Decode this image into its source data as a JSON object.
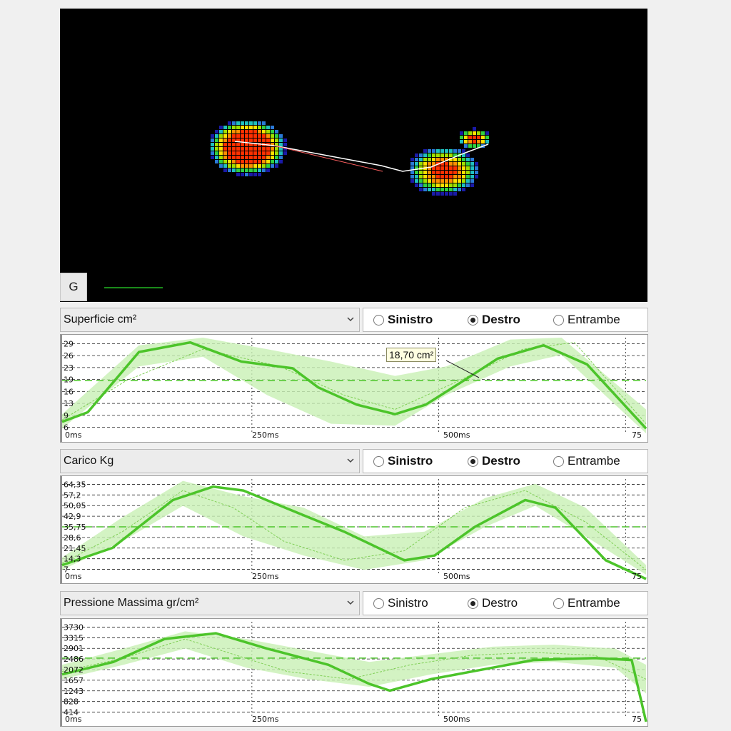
{
  "viewer": {
    "g_button_label": "G"
  },
  "panels": [
    {
      "dropdown_label": "Superficie cm²",
      "radios": [
        {
          "label": "Sinistro",
          "checked": false
        },
        {
          "label": "Destro",
          "checked": true
        },
        {
          "label": "Entrambe",
          "checked": false
        }
      ],
      "labels_bold": true,
      "tooltip": "18,70 cm²",
      "y_ticks": [
        "29",
        "26",
        "23",
        "19",
        "16",
        "13",
        "9",
        "6"
      ],
      "x_ticks": [
        "0ms",
        "250ms",
        "500ms",
        "75"
      ],
      "main_line": [
        [
          0,
          12
        ],
        [
          0.1,
          22
        ],
        [
          0.3,
          85
        ],
        [
          0.5,
          95
        ],
        [
          0.7,
          75
        ],
        [
          0.9,
          68
        ],
        [
          1.0,
          48
        ],
        [
          1.15,
          30
        ],
        [
          1.3,
          20
        ],
        [
          1.42,
          30
        ],
        [
          1.55,
          52
        ],
        [
          1.7,
          78
        ],
        [
          1.88,
          92
        ],
        [
          2.05,
          72
        ],
        [
          2.28,
          5
        ]
      ],
      "ghost_line": [
        [
          0,
          14
        ],
        [
          0.25,
          55
        ],
        [
          0.55,
          88
        ],
        [
          0.85,
          70
        ],
        [
          1.1,
          40
        ],
        [
          1.3,
          25
        ],
        [
          1.55,
          55
        ],
        [
          1.8,
          88
        ],
        [
          2.0,
          95
        ],
        [
          2.28,
          10
        ]
      ],
      "band_upper": [
        [
          0,
          20
        ],
        [
          0.3,
          92
        ],
        [
          0.55,
          100
        ],
        [
          0.8,
          88
        ],
        [
          1.05,
          75
        ],
        [
          1.3,
          60
        ],
        [
          1.5,
          70
        ],
        [
          1.75,
          98
        ],
        [
          1.95,
          100
        ],
        [
          2.28,
          25
        ]
      ],
      "band_lower": [
        [
          0,
          5
        ],
        [
          0.3,
          70
        ],
        [
          0.55,
          80
        ],
        [
          0.8,
          40
        ],
        [
          1.05,
          10
        ],
        [
          1.3,
          8
        ],
        [
          1.5,
          40
        ],
        [
          1.75,
          70
        ],
        [
          1.95,
          82
        ],
        [
          2.28,
          0
        ]
      ],
      "dash_level": 55
    },
    {
      "dropdown_label": "Carico Kg",
      "radios": [
        {
          "label": "Sinistro",
          "checked": false
        },
        {
          "label": "Destro",
          "checked": true
        },
        {
          "label": "Entrambe",
          "checked": false
        }
      ],
      "labels_bold": true,
      "tooltip": "",
      "y_ticks": [
        "64,35",
        "57,2",
        "50,05",
        "42,9",
        "35,75",
        "28,6",
        "21,45",
        "14,3",
        "7"
      ],
      "x_ticks": [
        "0ms",
        "250ms",
        "500ms",
        "75"
      ],
      "main_line": [
        [
          0,
          10
        ],
        [
          0.25,
          28
        ],
        [
          0.55,
          78
        ],
        [
          0.75,
          92
        ],
        [
          0.9,
          88
        ],
        [
          1.2,
          62
        ],
        [
          1.4,
          45
        ],
        [
          1.55,
          30
        ],
        [
          1.7,
          15
        ],
        [
          1.85,
          20
        ],
        [
          2.05,
          50
        ],
        [
          2.3,
          78
        ],
        [
          2.45,
          70
        ],
        [
          2.7,
          15
        ],
        [
          2.9,
          -5
        ]
      ],
      "ghost_line": [
        [
          0,
          12
        ],
        [
          0.3,
          45
        ],
        [
          0.6,
          88
        ],
        [
          0.85,
          70
        ],
        [
          1.1,
          35
        ],
        [
          1.4,
          15
        ],
        [
          1.7,
          25
        ],
        [
          2.0,
          70
        ],
        [
          2.3,
          88
        ],
        [
          2.6,
          55
        ],
        [
          2.9,
          5
        ]
      ],
      "band_upper": [
        [
          0,
          18
        ],
        [
          0.3,
          60
        ],
        [
          0.6,
          98
        ],
        [
          0.9,
          82
        ],
        [
          1.2,
          70
        ],
        [
          1.5,
          40
        ],
        [
          1.8,
          45
        ],
        [
          2.1,
          80
        ],
        [
          2.35,
          95
        ],
        [
          2.6,
          70
        ],
        [
          2.9,
          10
        ]
      ],
      "band_lower": [
        [
          0,
          5
        ],
        [
          0.3,
          35
        ],
        [
          0.6,
          72
        ],
        [
          0.9,
          40
        ],
        [
          1.2,
          20
        ],
        [
          1.5,
          5
        ],
        [
          1.8,
          15
        ],
        [
          2.1,
          50
        ],
        [
          2.35,
          72
        ],
        [
          2.6,
          40
        ],
        [
          2.9,
          0
        ]
      ],
      "dash_level": 50
    },
    {
      "dropdown_label": "Pressione Massima gr/cm²",
      "radios": [
        {
          "label": "Sinistro",
          "checked": false
        },
        {
          "label": "Destro",
          "checked": true
        },
        {
          "label": "Entrambe",
          "checked": false
        }
      ],
      "labels_bold": false,
      "tooltip": "",
      "y_ticks": [
        "3730",
        "3315",
        "2901",
        "2486",
        "2072",
        "1657",
        "1243",
        "828",
        "414"
      ],
      "x_ticks": [
        "0ms",
        "250ms",
        "500ms",
        "75"
      ],
      "main_line": [
        [
          0,
          45
        ],
        [
          0.25,
          58
        ],
        [
          0.5,
          82
        ],
        [
          0.75,
          88
        ],
        [
          1.0,
          72
        ],
        [
          1.3,
          55
        ],
        [
          1.5,
          35
        ],
        [
          1.6,
          28
        ],
        [
          1.8,
          40
        ],
        [
          2.0,
          48
        ],
        [
          2.3,
          60
        ],
        [
          2.6,
          62
        ],
        [
          2.78,
          60
        ],
        [
          2.85,
          -10
        ]
      ],
      "ghost_line": [
        [
          0,
          48
        ],
        [
          0.3,
          62
        ],
        [
          0.6,
          82
        ],
        [
          0.85,
          65
        ],
        [
          1.1,
          48
        ],
        [
          1.4,
          40
        ],
        [
          1.7,
          55
        ],
        [
          2.0,
          65
        ],
        [
          2.3,
          68
        ],
        [
          2.6,
          65
        ],
        [
          2.85,
          40
        ]
      ],
      "band_upper": [
        [
          0,
          55
        ],
        [
          0.3,
          72
        ],
        [
          0.6,
          90
        ],
        [
          0.9,
          82
        ],
        [
          1.2,
          70
        ],
        [
          1.5,
          58
        ],
        [
          1.8,
          66
        ],
        [
          2.1,
          74
        ],
        [
          2.4,
          76
        ],
        [
          2.7,
          72
        ],
        [
          2.85,
          55
        ]
      ],
      "band_lower": [
        [
          0,
          40
        ],
        [
          0.3,
          55
        ],
        [
          0.6,
          72
        ],
        [
          0.9,
          52
        ],
        [
          1.2,
          40
        ],
        [
          1.5,
          32
        ],
        [
          1.8,
          45
        ],
        [
          2.1,
          55
        ],
        [
          2.4,
          58
        ],
        [
          2.7,
          52
        ],
        [
          2.85,
          25
        ]
      ],
      "dash_level": 62
    }
  ],
  "colors": {
    "accent_green": "#4cc42a",
    "band_green": "#c8f0b4",
    "ghost_green": "#7fcf55"
  }
}
